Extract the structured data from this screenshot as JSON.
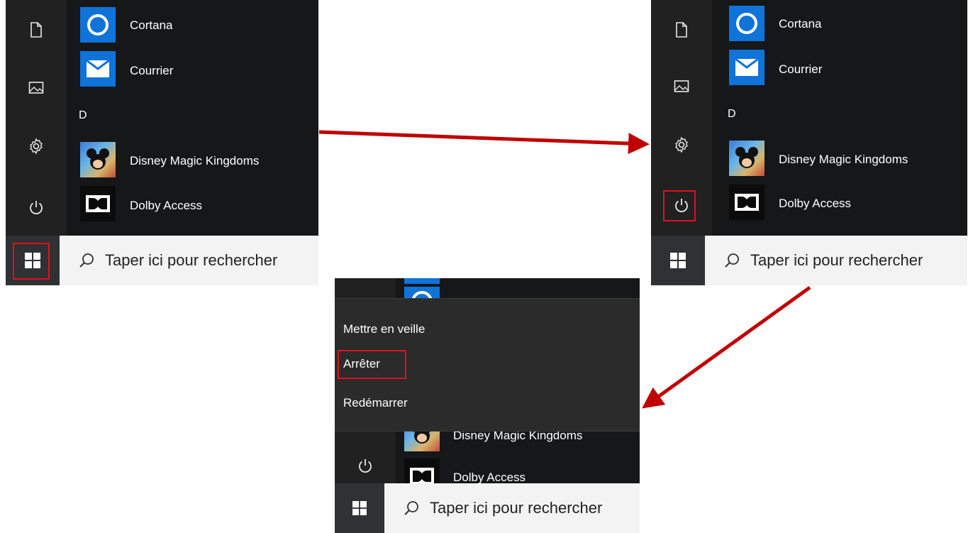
{
  "apps": {
    "cortana": "Cortana",
    "courrier": "Courrier",
    "letter_d": "D",
    "disney": "Disney Magic Kingdoms",
    "dolby": "Dolby Access"
  },
  "search": {
    "placeholder": "Taper ici pour rechercher"
  },
  "power_menu": {
    "items": [
      "Mettre en veille",
      "Arrêter",
      "Redémarrer"
    ]
  },
  "colors": {
    "highlight": "#e01020",
    "arrow": "#c00000",
    "tile_blue": "#0f73d8"
  },
  "icons": [
    "document-icon",
    "pictures-icon",
    "settings-gear-icon",
    "power-icon",
    "windows-logo-icon",
    "search-icon",
    "cortana-icon",
    "mail-icon",
    "dolby-icon",
    "disney-icon"
  ]
}
